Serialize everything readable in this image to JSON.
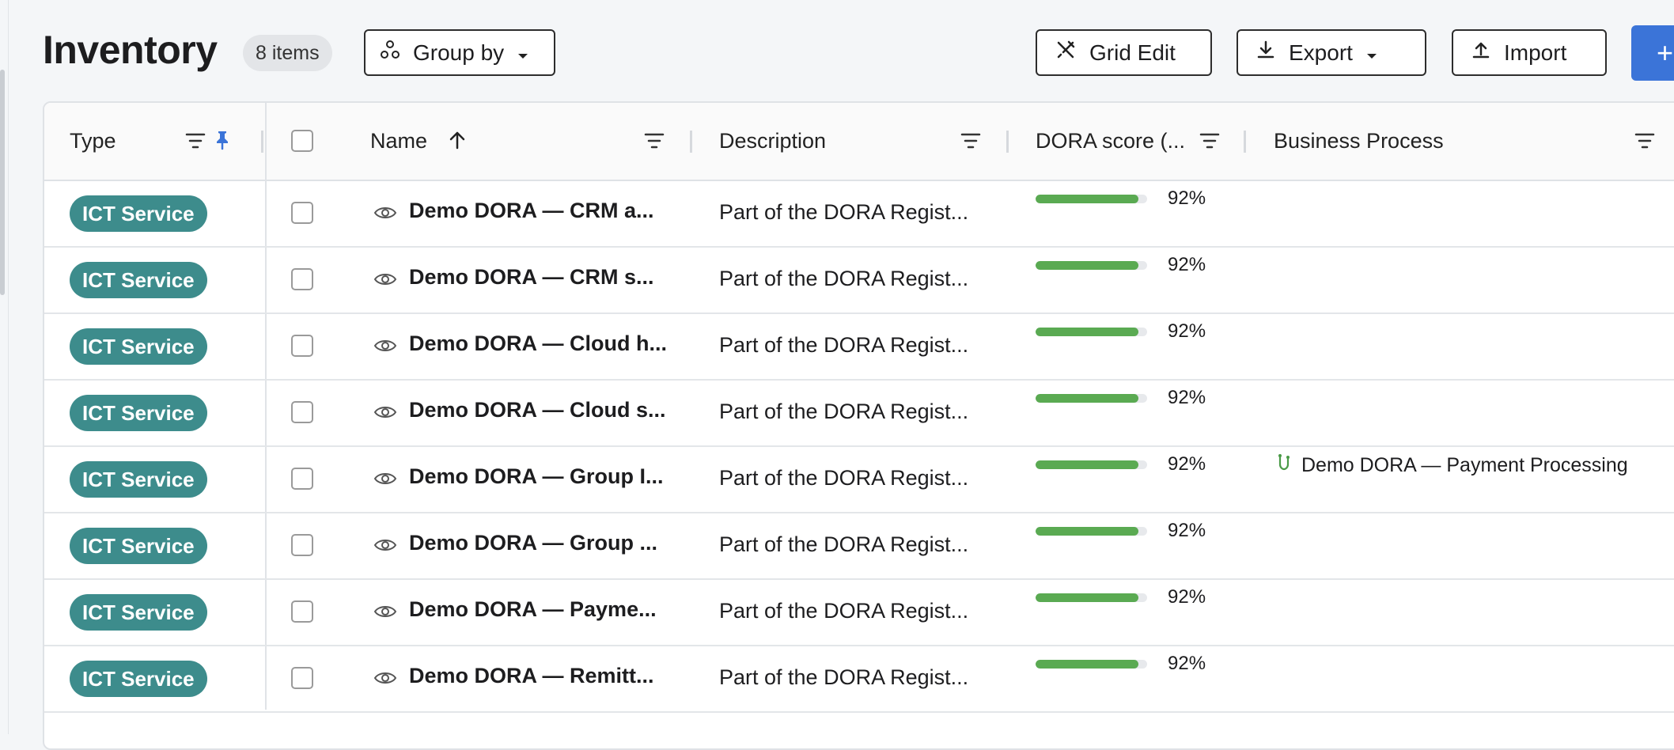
{
  "header": {
    "title": "Inventory",
    "item_count": "8 items",
    "group_by_label": "Group by",
    "grid_edit_label": "Grid Edit",
    "export_label": "Export",
    "import_label": "Import",
    "add_label": "+"
  },
  "table": {
    "columns": {
      "type": "Type",
      "name": "Name",
      "description": "Description",
      "dora_score": "DORA score (...",
      "business_process": "Business Process"
    },
    "sort": {
      "column": "name",
      "direction": "ascending"
    },
    "rows": [
      {
        "type": "ICT Service",
        "name": "Demo DORA — CRM a...",
        "description": "Part of the DORA Regist...",
        "score": "92%",
        "score_value": 0.92,
        "business_process": ""
      },
      {
        "type": "ICT Service",
        "name": "Demo DORA — CRM s...",
        "description": "Part of the DORA Regist...",
        "score": "92%",
        "score_value": 0.92,
        "business_process": ""
      },
      {
        "type": "ICT Service",
        "name": "Demo DORA — Cloud h...",
        "description": "Part of the DORA Regist...",
        "score": "92%",
        "score_value": 0.92,
        "business_process": ""
      },
      {
        "type": "ICT Service",
        "name": "Demo DORA — Cloud s...",
        "description": "Part of the DORA Regist...",
        "score": "92%",
        "score_value": 0.92,
        "business_process": ""
      },
      {
        "type": "ICT Service",
        "name": "Demo DORA — Group I...",
        "description": "Part of the DORA Regist...",
        "score": "92%",
        "score_value": 0.92,
        "business_process": "Demo DORA — Payment Processing"
      },
      {
        "type": "ICT Service",
        "name": "Demo DORA — Group ...",
        "description": "Part of the DORA Regist...",
        "score": "92%",
        "score_value": 0.92,
        "business_process": ""
      },
      {
        "type": "ICT Service",
        "name": "Demo DORA — Payme...",
        "description": "Part of the DORA Regist...",
        "score": "92%",
        "score_value": 0.92,
        "business_process": ""
      },
      {
        "type": "ICT Service",
        "name": "Demo DORA — Remitt...",
        "description": "Part of the DORA Regist...",
        "score": "92%",
        "score_value": 0.92,
        "business_process": ""
      }
    ]
  },
  "colors": {
    "type_badge": "#3d8c8c",
    "score_bar": "#5aaa52",
    "primary": "#3b74d8",
    "pin": "#3b74d8"
  },
  "icons": {
    "group_by": "group-nodes-icon",
    "grid_edit": "grid-edit-icon",
    "export": "download-icon",
    "import": "upload-icon",
    "filter": "filter-icon",
    "pin": "pin-icon",
    "sort": "arrow-up-icon",
    "row_view": "eye-icon",
    "business_process": "process-icon"
  }
}
